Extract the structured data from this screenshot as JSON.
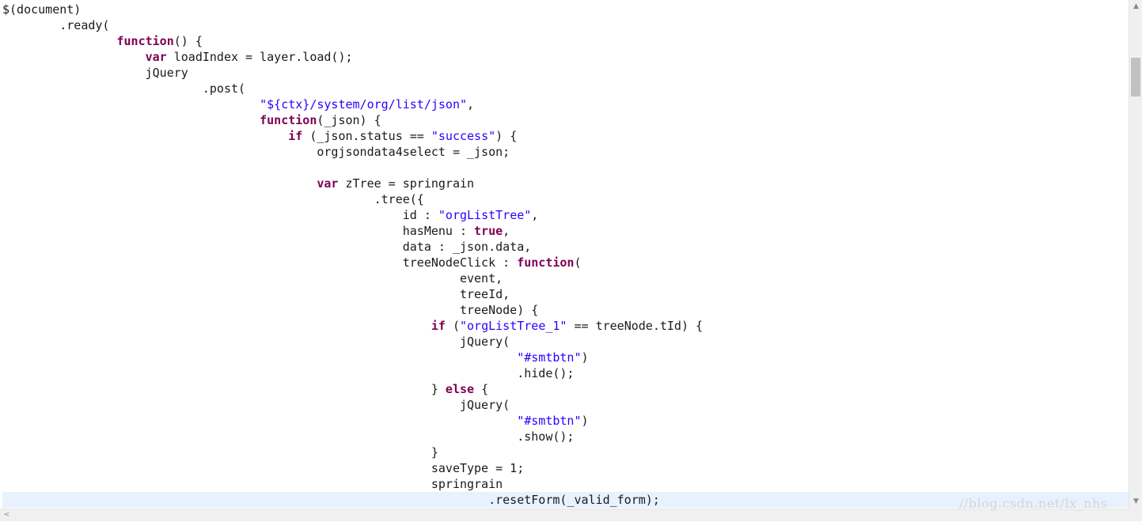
{
  "editor": {
    "current_line_index": 31,
    "lines": [
      [
        {
          "t": "$(document)",
          "c": "p"
        }
      ],
      [
        {
          "t": "        .ready(",
          "c": "p"
        }
      ],
      [
        {
          "t": "                ",
          "c": "p"
        },
        {
          "t": "function",
          "c": "k"
        },
        {
          "t": "() {",
          "c": "p"
        }
      ],
      [
        {
          "t": "                    ",
          "c": "p"
        },
        {
          "t": "var",
          "c": "k"
        },
        {
          "t": " loadIndex = layer.load();",
          "c": "p"
        }
      ],
      [
        {
          "t": "                    jQuery",
          "c": "p"
        }
      ],
      [
        {
          "t": "                            .post(",
          "c": "p"
        }
      ],
      [
        {
          "t": "                                    ",
          "c": "p"
        },
        {
          "t": "\"${ctx}/system/org/list/json\"",
          "c": "s"
        },
        {
          "t": ",",
          "c": "p"
        }
      ],
      [
        {
          "t": "                                    ",
          "c": "p"
        },
        {
          "t": "function",
          "c": "k"
        },
        {
          "t": "(_json) {",
          "c": "p"
        }
      ],
      [
        {
          "t": "                                        ",
          "c": "p"
        },
        {
          "t": "if",
          "c": "k"
        },
        {
          "t": " (_json.status == ",
          "c": "p"
        },
        {
          "t": "\"success\"",
          "c": "s"
        },
        {
          "t": ") {",
          "c": "p"
        }
      ],
      [
        {
          "t": "                                            orgjsondata4select = _json;",
          "c": "p"
        }
      ],
      [],
      [
        {
          "t": "                                            ",
          "c": "p"
        },
        {
          "t": "var",
          "c": "k"
        },
        {
          "t": " zTree = springrain",
          "c": "p"
        }
      ],
      [
        {
          "t": "                                                    .tree({",
          "c": "p"
        }
      ],
      [
        {
          "t": "                                                        id : ",
          "c": "p"
        },
        {
          "t": "\"orgListTree\"",
          "c": "s"
        },
        {
          "t": ",",
          "c": "p"
        }
      ],
      [
        {
          "t": "                                                        hasMenu : ",
          "c": "p"
        },
        {
          "t": "true",
          "c": "k"
        },
        {
          "t": ",",
          "c": "p"
        }
      ],
      [
        {
          "t": "                                                        data : _json.data,",
          "c": "p"
        }
      ],
      [
        {
          "t": "                                                        treeNodeClick : ",
          "c": "p"
        },
        {
          "t": "function",
          "c": "k"
        },
        {
          "t": "(",
          "c": "p"
        }
      ],
      [
        {
          "t": "                                                                event,",
          "c": "p"
        }
      ],
      [
        {
          "t": "                                                                treeId,",
          "c": "p"
        }
      ],
      [
        {
          "t": "                                                                treeNode) {",
          "c": "p"
        }
      ],
      [
        {
          "t": "                                                            ",
          "c": "p"
        },
        {
          "t": "if",
          "c": "k"
        },
        {
          "t": " (",
          "c": "p"
        },
        {
          "t": "\"orgListTree_1\"",
          "c": "s"
        },
        {
          "t": " == treeNode.tId) {",
          "c": "p"
        }
      ],
      [
        {
          "t": "                                                                jQuery(",
          "c": "p"
        }
      ],
      [
        {
          "t": "                                                                        ",
          "c": "p"
        },
        {
          "t": "\"#smtbtn\"",
          "c": "s"
        },
        {
          "t": ")",
          "c": "p"
        }
      ],
      [
        {
          "t": "                                                                        .hide();",
          "c": "p"
        }
      ],
      [
        {
          "t": "                                                            } ",
          "c": "p"
        },
        {
          "t": "else",
          "c": "k"
        },
        {
          "t": " {",
          "c": "p"
        }
      ],
      [
        {
          "t": "                                                                jQuery(",
          "c": "p"
        }
      ],
      [
        {
          "t": "                                                                        ",
          "c": "p"
        },
        {
          "t": "\"#smtbtn\"",
          "c": "s"
        },
        {
          "t": ")",
          "c": "p"
        }
      ],
      [
        {
          "t": "                                                                        .show();",
          "c": "p"
        }
      ],
      [
        {
          "t": "                                                            }",
          "c": "p"
        }
      ],
      [
        {
          "t": "                                                            saveType = 1;",
          "c": "p"
        }
      ],
      [
        {
          "t": "                                                            springrain",
          "c": "p"
        }
      ],
      [
        {
          "t": "                                                                    .resetForm(_valid_form);",
          "c": "p"
        }
      ]
    ]
  },
  "colors": {
    "keyword": "#7f0055",
    "string": "#2a00ff",
    "plain": "#1a1a1a",
    "current_line_bg": "#e8f2fe",
    "watermark": "#d5d5d5"
  },
  "scrollbar": {
    "up_icon": "triangle-up",
    "down_icon": "triangle-down",
    "left_icon": "chevron-left"
  },
  "watermark": {
    "text": "//blog.csdn.net/lx_nhs"
  }
}
